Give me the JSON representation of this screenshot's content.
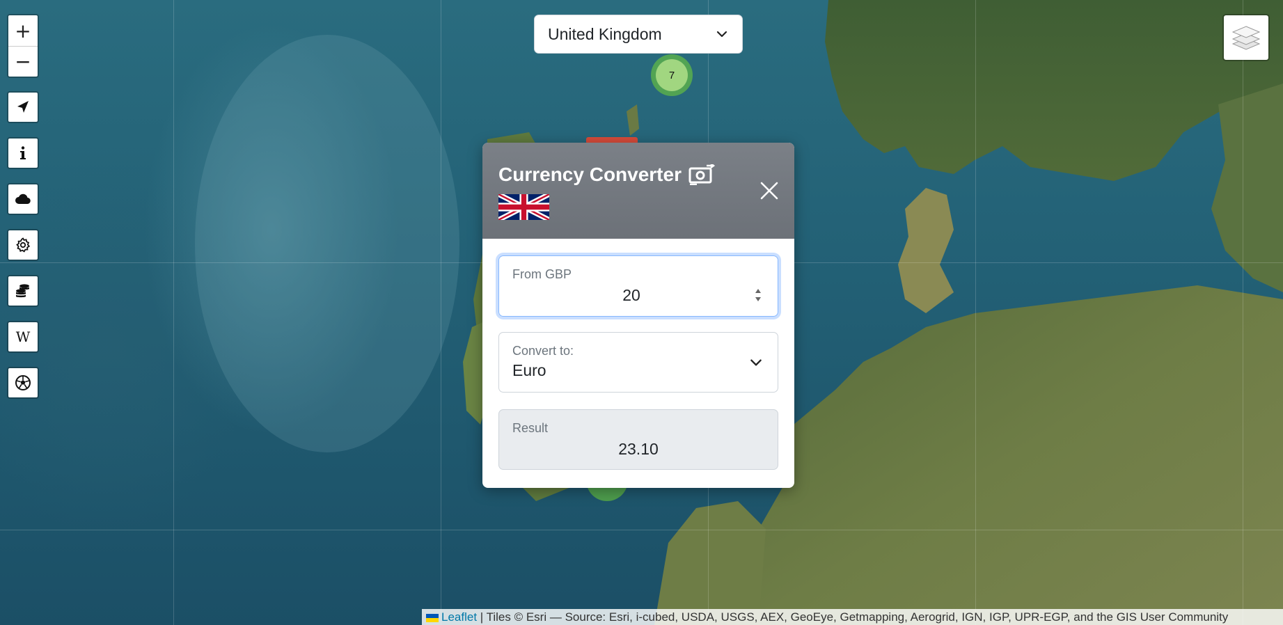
{
  "map": {
    "zoom_in": "+",
    "zoom_out": "−",
    "cluster_count": "7",
    "colors": {
      "sea": "#236176",
      "land": "#5b7a3f",
      "cluster": "#6ecc39"
    }
  },
  "side_buttons": [
    {
      "name": "locate-icon"
    },
    {
      "name": "info-icon"
    },
    {
      "name": "weather-cloud-icon"
    },
    {
      "name": "settings-gear-icon"
    },
    {
      "name": "currency-coins-icon"
    },
    {
      "name": "wikipedia-icon"
    },
    {
      "name": "football-icon"
    }
  ],
  "country_select": {
    "selected": "United Kingdom"
  },
  "modal": {
    "title": "Currency Converter",
    "from_label": "From GBP",
    "from_value": "20",
    "convert_label": "Convert to:",
    "convert_value": "Euro",
    "result_label": "Result",
    "result_value": "23.10",
    "header_color": "#73787f"
  },
  "attribution": {
    "leaflet": "Leaflet",
    "text": "| Tiles © Esri — Source: Esri, i-cubed, USDA, USGS, AEX, GeoEye, Getmapping, Aerogrid, IGN, IGP, UPR-EGP, and the GIS User Community"
  }
}
